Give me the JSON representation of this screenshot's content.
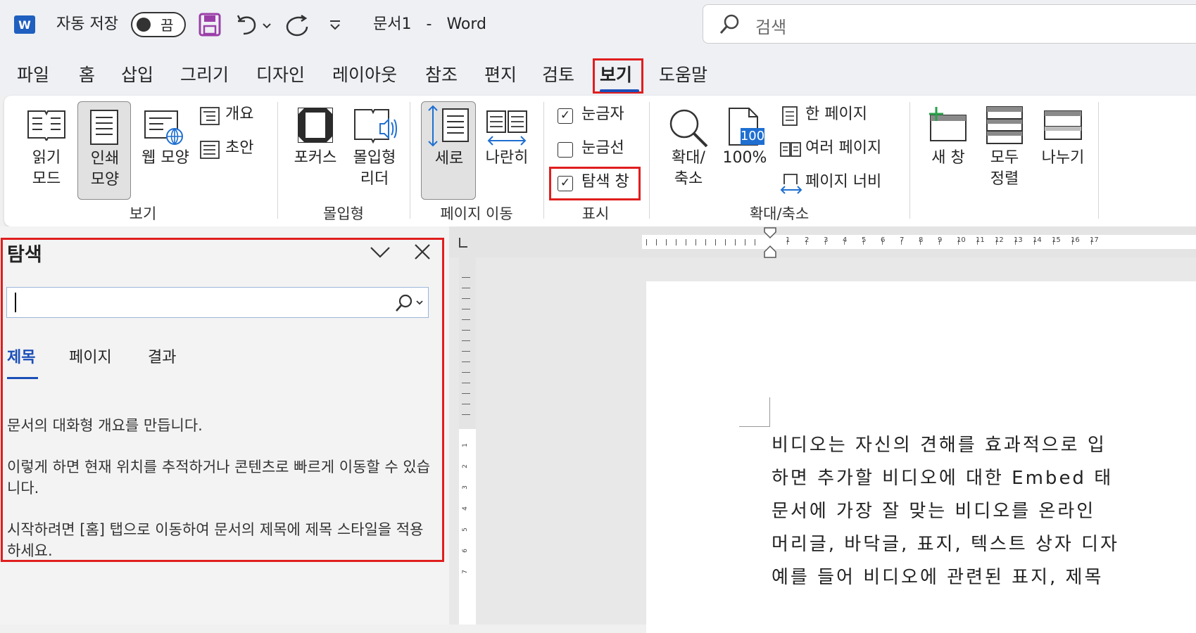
{
  "titlebar": {
    "app_icon": "word-icon",
    "autosave_label": "자동 저장",
    "autosave_state": "끔",
    "doc_title": "문서1",
    "dash": "-",
    "app_name": "Word",
    "search_placeholder": "검색"
  },
  "tabs": [
    "파일",
    "홈",
    "삽입",
    "그리기",
    "디자인",
    "레이아웃",
    "참조",
    "편지",
    "검토",
    "보기",
    "도움말"
  ],
  "active_tab": "보기",
  "ribbon": {
    "views": {
      "read_mode": [
        "읽기",
        "모드"
      ],
      "print_layout": [
        "인쇄",
        "모양"
      ],
      "web_layout": "웹 모양",
      "outline": "개요",
      "draft": "초안",
      "group": "보기"
    },
    "immersive": {
      "focus": "포커스",
      "immersive_reader": [
        "몰입형",
        "리더"
      ],
      "group": "몰입형"
    },
    "page_movement": {
      "vertical": "세로",
      "side_by_side": "나란히",
      "group": "페이지 이동"
    },
    "show": {
      "ruler": "눈금자",
      "gridlines": "눈금선",
      "nav_pane": "탐색 창",
      "ruler_checked": true,
      "gridlines_checked": false,
      "nav_pane_checked": true,
      "group": "표시"
    },
    "zoom": {
      "zoom": [
        "확대/",
        "축소"
      ],
      "hundred": "100%",
      "hundred_icon": "100",
      "one_page": "한 페이지",
      "multiple_pages": "여러 페이지",
      "page_width": "페이지 너비",
      "group": "확대/축소"
    },
    "window": {
      "new_window": "새 창",
      "arrange_all": [
        "모두",
        "정렬"
      ],
      "split": "나누기"
    }
  },
  "nav_pane": {
    "title": "탐색",
    "tabs": [
      "제목",
      "페이지",
      "결과"
    ],
    "active_tab": "제목",
    "paragraphs": [
      "문서의 대화형 개요를 만듭니다.",
      "이렇게 하면 현재 위치를 추적하거나 콘텐츠로 빠르게 이동할 수 있습니다.",
      "시작하려면 [홈] 탭으로 이동하여 문서의 제목에 제목 스타일을 적용하세요."
    ]
  },
  "ruler": {
    "marks": [
      "1",
      "2",
      "3",
      "4",
      "5",
      "6",
      "7",
      "8",
      "9",
      "10",
      "11",
      "12",
      "13",
      "14",
      "15",
      "16",
      "17"
    ]
  },
  "document": {
    "lines": [
      "비디오는 자신의 견해를 효과적으로 입",
      "하면 추가할 비디오에 대한 Embed 태",
      "문서에 가장 잘 맞는 비디오를 온라인",
      "머리글, 바닥글, 표지, 텍스트 상자 디자",
      "예를 들어 비디오에 관련된 표지, 제목"
    ]
  },
  "colors": {
    "accent": "#1b4fb8",
    "highlight": "#e01e1e",
    "word_blue": "#1f5fbf",
    "save_purple": "#9b3fa8"
  }
}
